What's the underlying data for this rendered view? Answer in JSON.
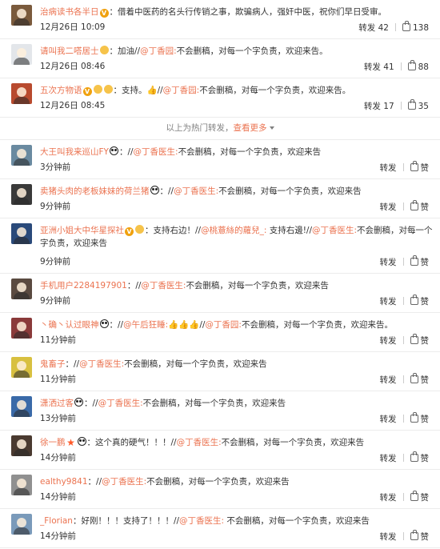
{
  "divider": {
    "text": "以上为热门转发，",
    "more": "查看更多"
  },
  "hot": [
    {
      "user": "治病读书各半日",
      "badges": [
        "v"
      ],
      "text": "借着中医药的名头行传销之事，欺骗病人，强奸中医，祝你们早日受审。",
      "time": "12月26日 10:09",
      "repost": "转发 42",
      "likes": "138",
      "avatar_color": "#7a5a3c"
    },
    {
      "user": "请叫我二嗒居士",
      "badges": [
        "medal"
      ],
      "text": "加油//@丁香园:不会删稿，对每一个字负责，欢迎来告。",
      "time": "12月26日 08:46",
      "repost": "转发 41",
      "likes": "88",
      "avatar_color": "#e3e6ea"
    },
    {
      "user": "五次方物语",
      "badges": [
        "v",
        "medal",
        "medal"
      ],
      "text": "支持。👍//@丁香园:不会删稿，对每一个字负责，欢迎来告。",
      "time": "12月26日 08:45",
      "repost": "转发 17",
      "likes": "35",
      "avatar_color": "#b84a2e"
    }
  ],
  "rest": [
    {
      "user": "大王叫我来巡山FY",
      "badges": [
        "panda"
      ],
      "text": "//@丁香医生:不会删稿，对每一个字负责，欢迎来告",
      "time": "3分钟前",
      "repost": "转发",
      "likes": "赞",
      "avatar_color": "#6a8aa0"
    },
    {
      "user": "卖猪头肉的老板妹妹的荷兰猪",
      "badges": [
        "panda"
      ],
      "text": "//@丁香医生:不会删稿，对每一个字负责，欢迎来告",
      "time": "9分钟前",
      "repost": "转发",
      "likes": "赞",
      "avatar_color": "#3a3a3a"
    },
    {
      "user": "亚洲小姐大中华星探社",
      "badges": [
        "v",
        "medal"
      ],
      "text": "支持右边！//@桃薏絲的蘿兒_: 支持右邊!//@丁香医生:不会删稿，对每一个字负责，欢迎来告",
      "time": "9分钟前",
      "repost": "转发",
      "likes": "赞",
      "avatar_color": "#2a4a7a",
      "tall": true
    },
    {
      "user": "手机用户2284197901",
      "badges": [],
      "text": "//@丁香医生:不会删稿，对每一个字负责，欢迎来告",
      "time": "9分钟前",
      "repost": "转发",
      "likes": "赞",
      "avatar_color": "#5a4a40"
    },
    {
      "user": "丶确丶认过眼神",
      "badges": [
        "panda"
      ],
      "text": "//@午后狂睡:👍👍👍//@丁香园:不会删稿，对每一个字负责，欢迎来告。",
      "time": "11分钟前",
      "repost": "转发",
      "likes": "赞",
      "avatar_color": "#8a3a3a"
    },
    {
      "user": "鬼畜子",
      "badges": [],
      "text": "//@丁香医生:不会删稿，对每一个字负责，欢迎来告",
      "time": "11分钟前",
      "repost": "转发",
      "likes": "赞",
      "avatar_color": "#d8c040"
    },
    {
      "user": "潇洒过客",
      "badges": [
        "panda"
      ],
      "text": "//@丁香医生:不会删稿，对每一个字负责，欢迎来告",
      "time": "13分钟前",
      "repost": "转发",
      "likes": "赞",
      "avatar_color": "#3a6aa8"
    },
    {
      "user": "徐一鹏",
      "badges": [
        "star",
        "panda"
      ],
      "text": "这个真的硬气！！！//@丁香医生:不会删稿，对每一个字负责，欢迎来告",
      "time": "14分钟前",
      "repost": "转发",
      "likes": "赞",
      "avatar_color": "#4a3a30"
    },
    {
      "user": "ealthy9841",
      "badges": [],
      "text": "//@丁香医生:不会删稿，对每一个字负责，欢迎来告",
      "time": "14分钟前",
      "repost": "转发",
      "likes": "赞",
      "avatar_color": "#909090"
    },
    {
      "user": "_Florian",
      "badges": [],
      "text": "好刚！！！支持了！！！//@丁香医生: 不会删稿，对每一个字负责，欢迎来告",
      "time": "14分钟前",
      "repost": "转发",
      "likes": "赞",
      "avatar_color": "#7a9aba"
    }
  ]
}
